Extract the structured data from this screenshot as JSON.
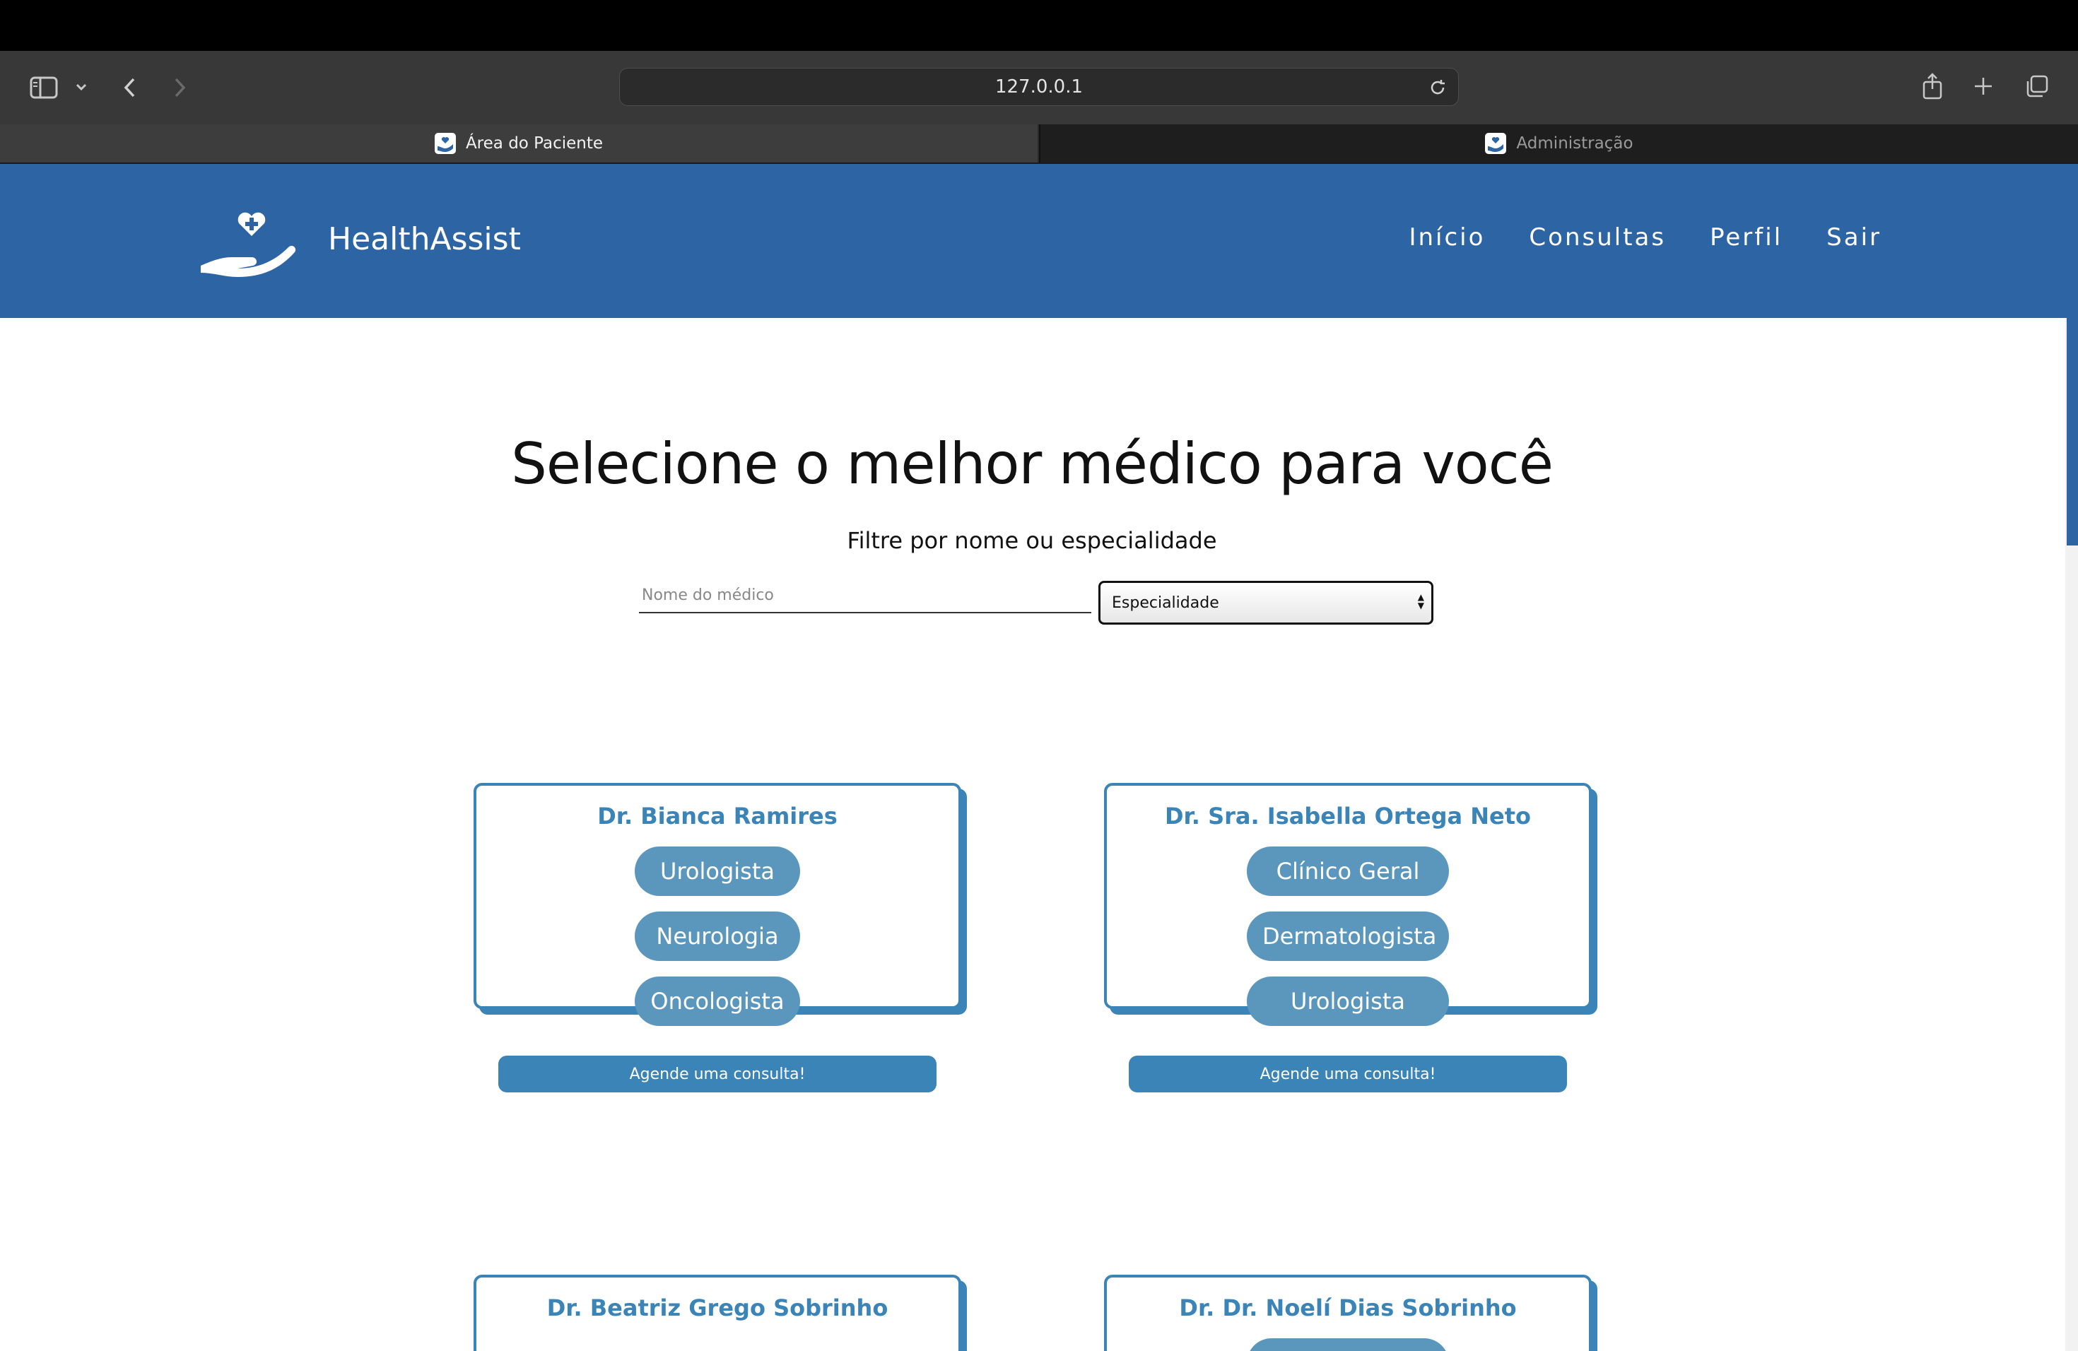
{
  "browser": {
    "url": "127.0.0.1",
    "tabs": [
      {
        "label": "Área do Paciente",
        "active": true
      },
      {
        "label": "Administração",
        "active": false
      }
    ]
  },
  "header": {
    "brand": "HealthAssist",
    "nav": [
      "Início",
      "Consultas",
      "Perfil",
      "Sair"
    ],
    "color": "#2d65a4"
  },
  "main": {
    "title": "Selecione o melhor médico para você",
    "subtitle": "Filtre por nome ou especialidade",
    "name_placeholder": "Nome do médico",
    "specialty_select": "Especialidade"
  },
  "doctors": [
    {
      "name": "Dr. Bianca Ramires",
      "specialties": [
        "Urologista",
        "Neurologia",
        "Oncologista"
      ],
      "cta": "Agende uma consulta!"
    },
    {
      "name": "Dr. Sra. Isabella Ortega Neto",
      "specialties": [
        "Clínico Geral",
        "Dermatologista",
        "Urologista"
      ],
      "cta": "Agende uma consulta!"
    },
    {
      "name": "Dr. Beatriz Grego Sobrinho",
      "specialties": [],
      "cta": ""
    },
    {
      "name": "Dr. Dr. Noelí Dias Sobrinho",
      "specialties": [],
      "cta": ""
    }
  ],
  "colors": {
    "accent": "#3a84b8",
    "pill": "#5b97bd"
  }
}
